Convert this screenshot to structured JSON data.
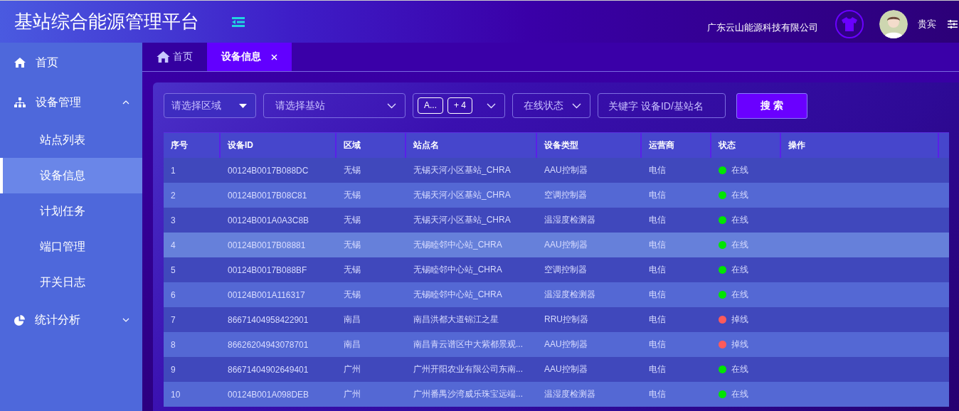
{
  "header": {
    "title": "基站综合能源管理平台",
    "company": "广东云山能源科技有限公司",
    "user": "贵宾"
  },
  "sidebar": {
    "items": [
      {
        "label": "首页",
        "selected": false
      },
      {
        "label": "设备管理",
        "expanded": true,
        "selected": false,
        "children": [
          {
            "label": "站点列表",
            "selected": false
          },
          {
            "label": "设备信息",
            "selected": true
          },
          {
            "label": "计划任务",
            "selected": false
          },
          {
            "label": "端口管理",
            "selected": false
          },
          {
            "label": "开关日志",
            "selected": false
          }
        ]
      },
      {
        "label": "统计分析",
        "expanded": false,
        "selected": false
      }
    ]
  },
  "tabs": [
    {
      "label": "首页",
      "selected": false,
      "closable": false
    },
    {
      "label": "设备信息",
      "selected": true,
      "closable": true
    }
  ],
  "filters": [
    {
      "kind": "dropdown",
      "placeholder": "请选择区域"
    },
    {
      "kind": "select",
      "placeholder": "请选择基站"
    },
    {
      "kind": "tags",
      "tags": [
        "A...",
        "+ 4"
      ]
    },
    {
      "kind": "select",
      "placeholder": "在线状态"
    },
    {
      "kind": "input",
      "placeholder": "关键字 设备ID/基站名"
    },
    {
      "kind": "button",
      "label": "搜 索"
    }
  ],
  "table": {
    "columns": [
      "序号",
      "设备ID",
      "区域",
      "站点名",
      "设备类型",
      "运营商",
      "状态",
      "操作"
    ],
    "rows": [
      {
        "selected": false,
        "cells": [
          "1",
          "00124B0017B088DC",
          "无锡",
          "无锡天河小区基站_CHRA",
          "AAU控制器",
          "电信"
        ],
        "status": "在线",
        "color": "#00e600"
      },
      {
        "selected": false,
        "cells": [
          "2",
          "00124B0017B08C81",
          "无锡",
          "无锡天河小区基站_CHRA",
          "空调控制器",
          "电信"
        ],
        "status": "在线",
        "color": "#00e600"
      },
      {
        "selected": false,
        "cells": [
          "3",
          "00124B001A0A3C8B",
          "无锡",
          "无锡天河小区基站_CHRA",
          "温湿度检测器",
          "电信"
        ],
        "status": "在线",
        "color": "#00e600"
      },
      {
        "selected": true,
        "cells": [
          "4",
          "00124B0017B08881",
          "无锡",
          "无锡睦邻中心站_CHRA",
          "AAU控制器",
          "电信"
        ],
        "status": "在线",
        "color": "#00e600"
      },
      {
        "selected": false,
        "cells": [
          "5",
          "00124B0017B088BF",
          "无锡",
          "无锡睦邻中心站_CHRA",
          "空调控制器",
          "电信"
        ],
        "status": "在线",
        "color": "#00e600"
      },
      {
        "selected": false,
        "cells": [
          "6",
          "00124B001A116317",
          "无锡",
          "无锡睦邻中心站_CHRA",
          "温湿度检测器",
          "电信"
        ],
        "status": "在线",
        "color": "#00e600"
      },
      {
        "selected": false,
        "cells": [
          "7",
          "86671404958422901",
          "南昌",
          "南昌洪都大道锦江之星",
          "RRU控制器",
          "电信"
        ],
        "status": "掉线",
        "color": "#ff5a5a"
      },
      {
        "selected": false,
        "cells": [
          "8",
          "86626204943078701",
          "南昌",
          "南昌青云谱区中大紫都景观...",
          "AAU控制器",
          "电信"
        ],
        "status": "掉线",
        "color": "#ff5a5a"
      },
      {
        "selected": false,
        "cells": [
          "9",
          "86671404902649401",
          "广州",
          "广州开阳农业有限公司东南...",
          "AAU控制器",
          "电信"
        ],
        "status": "在线",
        "color": "#00e600"
      },
      {
        "selected": false,
        "cells": [
          "10",
          "00124B001A098DEB",
          "广州",
          "广州番禺沙湾威乐珠宝远端...",
          "温湿度检测器",
          "电信"
        ],
        "status": "在线",
        "color": "#00e600"
      }
    ]
  }
}
